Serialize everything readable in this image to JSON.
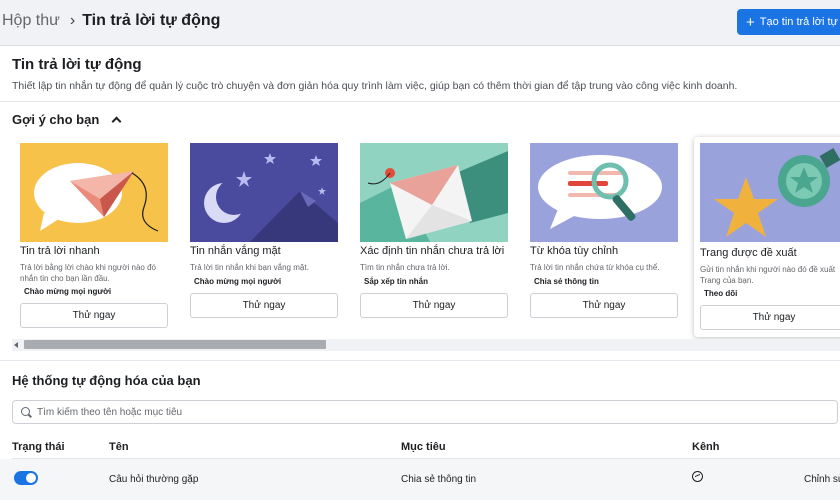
{
  "breadcrumb": {
    "parent": "Hộp thư",
    "current": "Tin trả lời tự động"
  },
  "header": {
    "create_button": "Tạo tin trả lời tự động"
  },
  "page": {
    "title": "Tin trả lời tự động",
    "description": "Thiết lập tin nhắn tự động để quản lý cuộc trò chuyện và đơn giản hóa quy trình làm việc, giúp bạn có thêm thời gian để tập trung vào công việc kinh doanh."
  },
  "suggestions": {
    "heading": "Gợi ý cho bạn",
    "cards": [
      {
        "title": "Tin trả lời nhanh",
        "desc": "Trả lời bằng lời chào khi người nào đó nhắn tin cho bạn lần đầu.",
        "tag": "Chào mừng mọi người",
        "button": "Thử ngay"
      },
      {
        "title": "Tin nhắn vắng mặt",
        "desc": "Trả lời tin nhắn khi bạn vắng mặt.",
        "tag": "Chào mừng mọi người",
        "button": "Thử ngay"
      },
      {
        "title": "Xác định tin nhắn chưa trả lời",
        "desc": "Tìm tin nhắn chưa trả lời.",
        "tag": "Sắp xếp tin nhắn",
        "button": "Thử ngay"
      },
      {
        "title": "Từ khóa tùy chỉnh",
        "desc": "Trả lời tin nhắn chứa từ khóa cụ thể.",
        "tag": "Chia sẻ thông tin",
        "button": "Thử ngay"
      },
      {
        "title": "Trang được đề xuất",
        "desc": "Gửi tin nhắn khi người nào đó đề xuất Trang của bạn.",
        "tag": "Theo dõi",
        "button": "Thử ngay"
      }
    ]
  },
  "automations": {
    "heading": "Hệ thống tự động hóa của bạn",
    "search_placeholder": "Tìm kiếm theo tên hoặc mục tiêu",
    "columns": {
      "status": "Trạng thái",
      "name": "Tên",
      "goal": "Mục tiêu",
      "channel": "Kênh"
    },
    "rows": [
      {
        "enabled": true,
        "name": "Câu hỏi thường gặp",
        "goal": "Chia sẻ thông tin",
        "channel_icon": "messenger-icon",
        "action": "Chỉnh sửa"
      }
    ]
  },
  "colors": {
    "accent": "#1b74e4"
  }
}
